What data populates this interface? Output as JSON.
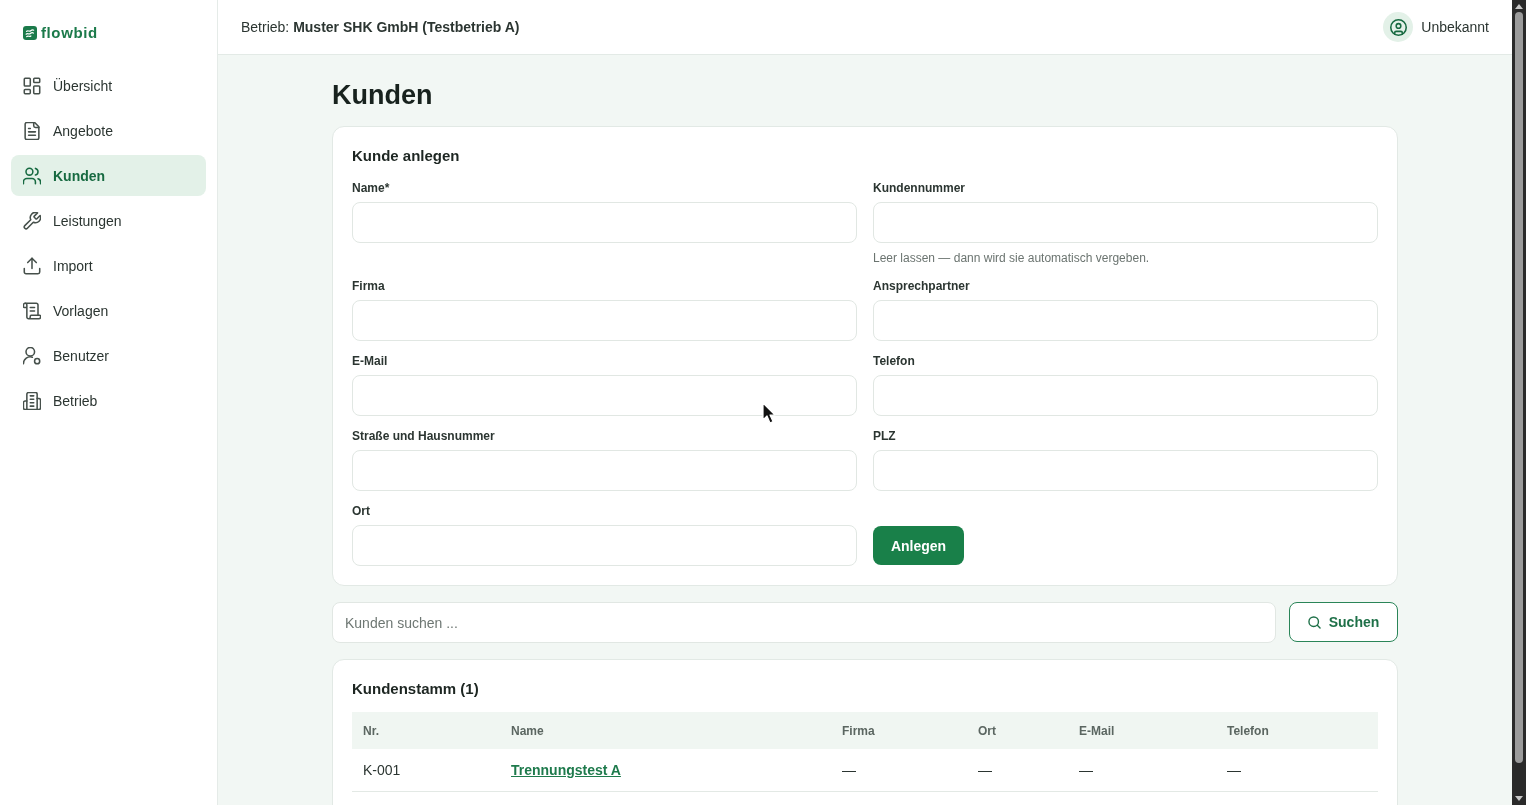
{
  "sidebar": {
    "logo": "flowbid",
    "items": [
      {
        "label": "Übersicht",
        "selected": false
      },
      {
        "label": "Angebote",
        "selected": false
      },
      {
        "label": "Kunden",
        "selected": true
      },
      {
        "label": "Leistungen",
        "selected": false
      },
      {
        "label": "Import",
        "selected": false
      },
      {
        "label": "Vorlagen",
        "selected": false
      },
      {
        "label": "Benutzer",
        "selected": false
      },
      {
        "label": "Betrieb",
        "selected": false
      }
    ]
  },
  "header": {
    "business": "Betrieb: **Muster SHK GmbH (Testbetrieb A)**",
    "user_name": "Unbekannt"
  },
  "page_title": "Kunden",
  "create_form": {
    "title": "Kunde anlegen",
    "fields": [
      {
        "label": "Name*"
      },
      {
        "label": "Kundennummer",
        "hint": "Leer lassen — dann wird sie automatisch vergeben."
      },
      {
        "label": "Firma"
      },
      {
        "label": "Ansprechpartner"
      },
      {
        "label": "E-Mail"
      },
      {
        "label": "Telefon"
      },
      {
        "label": "Straße und Hausnummer"
      },
      {
        "label": "PLZ"
      },
      {
        "label": "Ort"
      }
    ],
    "submit_button": "Anlegen"
  },
  "search": {
    "placeholder": "Kunden suchen ...",
    "button": "Suchen"
  },
  "customer_table": {
    "title": "Kundenstamm (1)",
    "columns": [
      "Nr.",
      "Name",
      "Firma",
      "Ort",
      "E-Mail",
      "Telefon"
    ],
    "rows": [
      {
        "cells": [
          {
            "kind": "text",
            "text": "K-001"
          },
          {
            "kind": "link",
            "text": "Trennungstest A"
          },
          {
            "kind": "text",
            "text": "—"
          },
          {
            "kind": "text",
            "text": "—"
          },
          {
            "kind": "text",
            "text": "—"
          },
          {
            "kind": "text",
            "text": "—"
          }
        ]
      }
    ]
  }
}
